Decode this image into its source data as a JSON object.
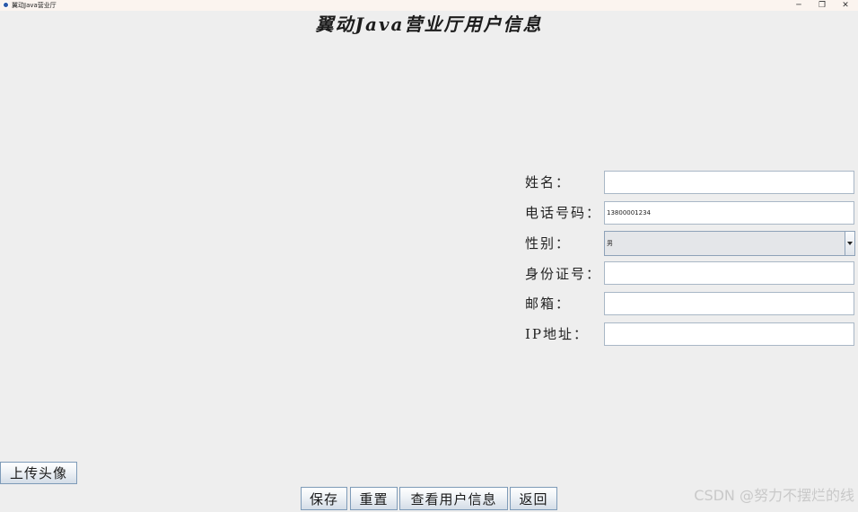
{
  "window": {
    "title": "翼动Java营业厅",
    "minimize": "─",
    "maximize": "❐",
    "close": "✕"
  },
  "page_title": "翼动Java营业厅用户信息",
  "form": {
    "name_label": "姓名：",
    "name_value": "",
    "phone_label": "电话号码：",
    "phone_value": "13800001234",
    "gender_label": "性别：",
    "gender_value": "男",
    "id_label": "身份证号：",
    "id_value": "",
    "email_label": "邮箱：",
    "email_value": "",
    "ip_label": "IP地址：",
    "ip_value": ""
  },
  "buttons": {
    "upload_avatar": "上传头像",
    "save": "保存",
    "reset": "重置",
    "view_info": "查看用户信息",
    "back": "返回"
  },
  "watermark": "CSDN @努力不摆烂的线",
  "icons": {
    "app": "app-icon",
    "dropdown": "chevron-down-icon"
  }
}
